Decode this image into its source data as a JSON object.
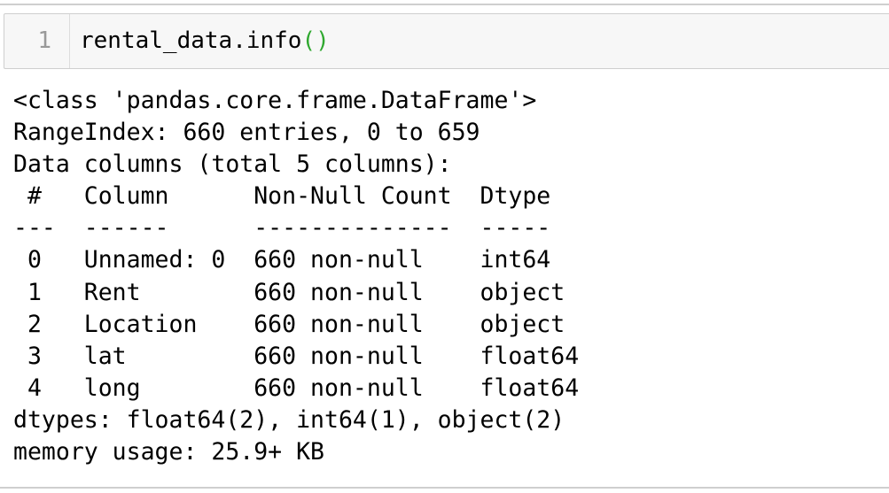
{
  "cell": {
    "line_number": "1",
    "code_object": "rental_data",
    "code_method": ".info",
    "code_parens": "()"
  },
  "output": {
    "lines": [
      "<class 'pandas.core.frame.DataFrame'>",
      "RangeIndex: 660 entries, 0 to 659",
      "Data columns (total 5 columns):",
      " #   Column      Non-Null Count  Dtype  ",
      "---  ------      --------------  -----  ",
      " 0   Unnamed: 0  660 non-null    int64  ",
      " 1   Rent        660 non-null    object ",
      " 2   Location    660 non-null    object ",
      " 3   lat         660 non-null    float64",
      " 4   long        660 non-null    float64",
      "dtypes: float64(2), int64(1), object(2)",
      "memory usage: 25.9+ KB"
    ]
  },
  "colors": {
    "paren_green": "#2fa82f",
    "cell_background": "#f7f7f7",
    "border_gray": "#cfcfcf",
    "line_number_gray": "#999999"
  }
}
